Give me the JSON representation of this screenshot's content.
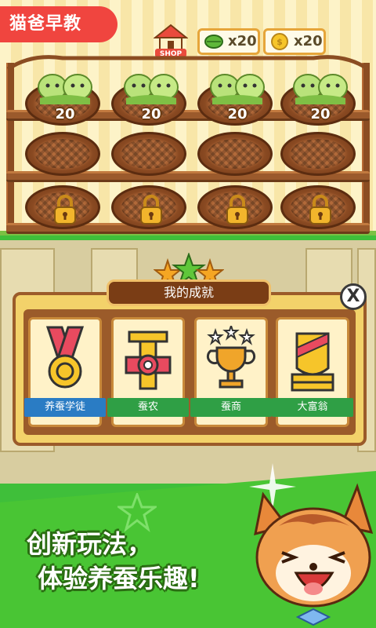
{
  "brand": {
    "label": "猫爸早教",
    "color": "#f0453f"
  },
  "toolbar": {
    "shop_label": "SHOP",
    "leaf_count": "x20",
    "coin_count": "x20"
  },
  "shelf": {
    "row1": [
      {
        "count": "20"
      },
      {
        "count": "20"
      },
      {
        "count": "20"
      },
      {
        "count": "20"
      }
    ],
    "row3_locked": [
      true,
      true,
      true,
      true
    ]
  },
  "achievements": {
    "title": "我的成就",
    "close_label": "X",
    "items": [
      {
        "label": "养蚕学徒",
        "icon": "medal-icon"
      },
      {
        "label": "蚕农",
        "icon": "cross-badge-icon"
      },
      {
        "label": "蚕商",
        "icon": "trophy-icon"
      },
      {
        "label": "大富翁",
        "icon": "shield-icon"
      }
    ]
  },
  "slogan": {
    "line1": "创新玩法，",
    "line2": "体验养蚕乐趣!"
  }
}
